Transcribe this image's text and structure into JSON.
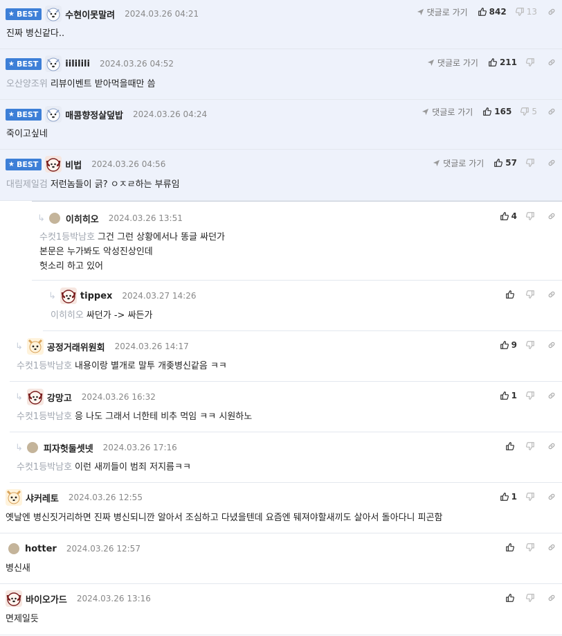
{
  "labels": {
    "best": "BEST",
    "goto": "댓글로 가기"
  },
  "colors": {
    "best_bg": "#eef2fb",
    "badge": "#3d7fd7",
    "mention": "#a0a6b0"
  },
  "comments": [
    {
      "nick": "수현이못말려",
      "date": "2024.03.26 04:21",
      "likes": "842",
      "dislikes": "13",
      "mention": "",
      "lines": [
        "진짜 병신같다.."
      ]
    },
    {
      "nick": "iililili",
      "date": "2024.03.26 04:52",
      "likes": "211",
      "dislikes": "",
      "mention": "오산양조위",
      "lines": [
        "리뷰이벤트 받아먹을때만 씀"
      ]
    },
    {
      "nick": "매콤향정살덮밥",
      "date": "2024.03.26 04:24",
      "likes": "165",
      "dislikes": "5",
      "mention": "",
      "lines": [
        "죽이고싶네"
      ]
    },
    {
      "nick": "비법",
      "date": "2024.03.26 04:56",
      "likes": "57",
      "dislikes": "",
      "mention": "대림제일검",
      "lines": [
        "저런놈들이 긁? ㅇㅈㄹ하는 부류임"
      ]
    },
    {
      "nick": "이히히오",
      "date": "2024.03.26 13:51",
      "likes": "4",
      "mention": "수컷1등박남호",
      "lines": [
        "그건 그런 상황에서나 똥글 싸던가",
        "본문은 누가봐도 악성진상인데",
        "헛소리 하고 있어"
      ]
    },
    {
      "nick": "tippex",
      "date": "2024.03.27 14:26",
      "likes": "",
      "mention": "이히히오",
      "lines": [
        "싸던가 -> 싸든가"
      ]
    },
    {
      "nick": "공정거래위원회",
      "date": "2024.03.26 14:17",
      "likes": "9",
      "mention": "수컷1등박남호",
      "lines": [
        "내용이랑 별개로 말투 개좆병신같음 ㅋㅋ"
      ]
    },
    {
      "nick": "강망고",
      "date": "2024.03.26 16:32",
      "likes": "1",
      "mention": "수컷1등박남호",
      "lines": [
        "응 나도 그래서 너한테 비추 먹임 ㅋㅋ 시원하노"
      ]
    },
    {
      "nick": "피자헛둘셋넷",
      "date": "2024.03.26 17:16",
      "likes": "",
      "mention": "수컷1등박남호",
      "lines": [
        "이런 새끼들이 범죄 저지름ㅋㅋ"
      ]
    },
    {
      "nick": "샤커레토",
      "date": "2024.03.26 12:55",
      "likes": "1",
      "mention": "",
      "lines": [
        "옛날엔 병신짓거리하면 진짜 병신되니깐 알아서 조심하고 다녔을텐데 요즘엔 뒈져야할새끼도 살아서 돌아다니 피곤함"
      ]
    },
    {
      "nick": "hotter",
      "date": "2024.03.26 12:57",
      "likes": "",
      "mention": "",
      "lines": [
        "병신새"
      ]
    },
    {
      "nick": "바이오가드",
      "date": "2024.03.26 13:16",
      "likes": "",
      "mention": "",
      "lines": [
        "면제일듯"
      ]
    }
  ]
}
